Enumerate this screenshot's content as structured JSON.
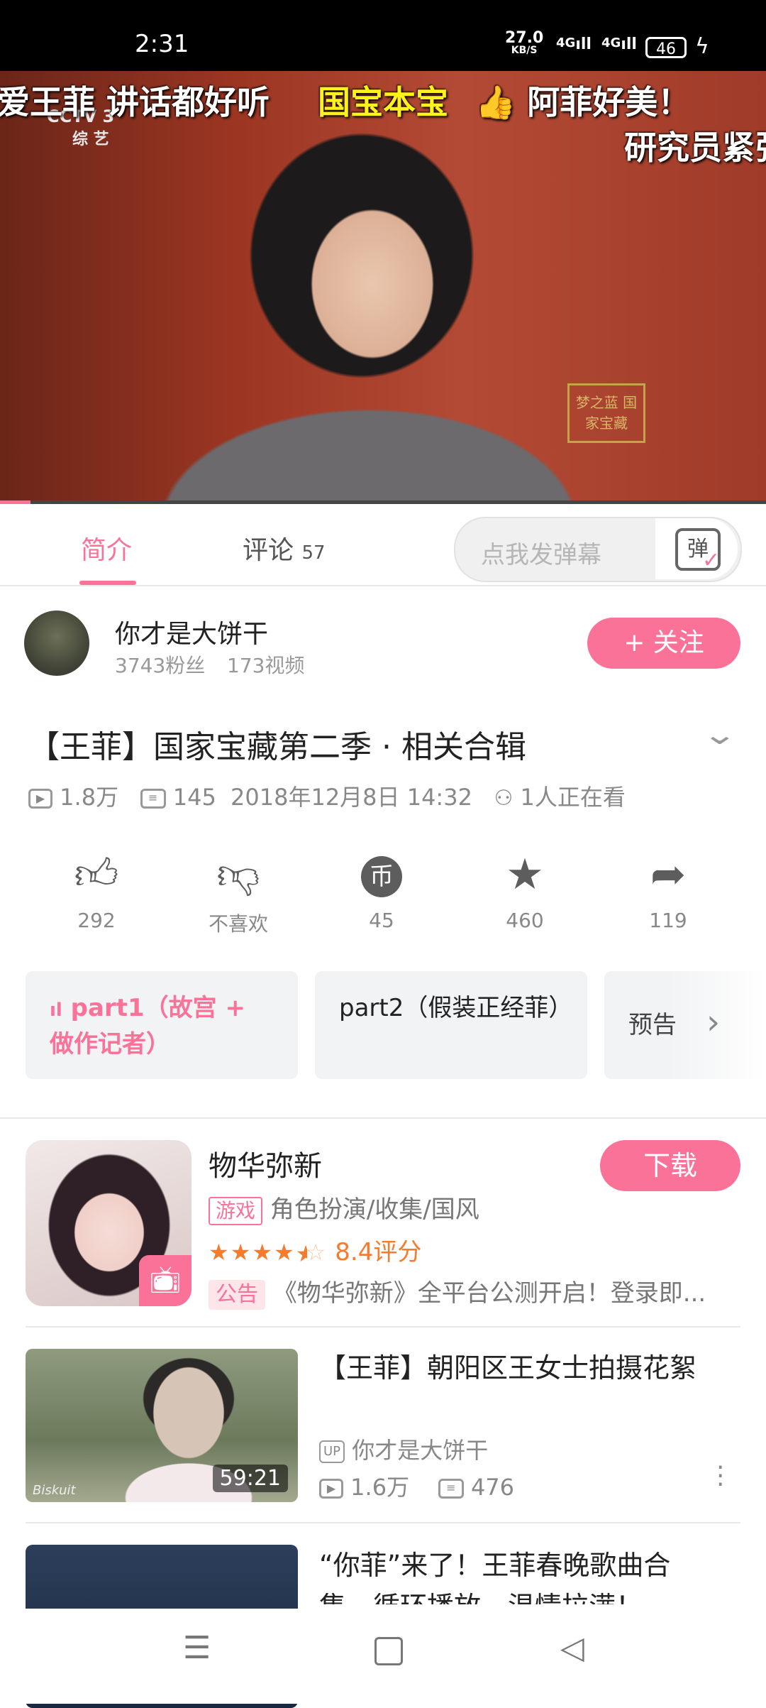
{
  "status_bar": {
    "time": "2:31",
    "speed": "27.0",
    "speed_unit": "KB/S",
    "signal1": "4G",
    "signal2": "4G",
    "battery": "46"
  },
  "video": {
    "channel_logo": "CCTV 3",
    "channel_sub": "综 艺",
    "watermark": "梦之蓝 国家宝藏",
    "danmaku": [
      {
        "text": "爱王菲 讲话都好听",
        "color": "#ffffff"
      },
      {
        "text": "国宝本宝",
        "color": "#fff21a"
      },
      {
        "text": "👍 阿菲好美！",
        "color": "#ffffff"
      },
      {
        "text": "研究员紧张",
        "color": "#ffffff"
      }
    ],
    "progress_fraction": 0.04
  },
  "tabs": {
    "intro": "简介",
    "comments": "评论",
    "comments_count": "57",
    "danmu_placeholder": "点我发弹幕",
    "danmu_button": "弹"
  },
  "uploader": {
    "name": "你才是大饼干",
    "fans": "3743粉丝",
    "videos": "173视频",
    "follow": "+ 关注"
  },
  "video_info": {
    "title": "【王菲】国家宝藏第二季 · 相关合辑",
    "views": "1.8万",
    "danmaku_count": "145",
    "date": "2018年12月8日 14:32",
    "watching": "1人正在看"
  },
  "actions": {
    "like": "292",
    "dislike": "不喜欢",
    "coin": "45",
    "favorite": "460",
    "share": "119"
  },
  "parts": [
    "part1（故宫 + 做作记者）",
    "part2（假装正经菲）",
    "预告"
  ],
  "ad": {
    "name": "物华弥新",
    "tag": "游戏",
    "genres": "角色扮演/收集/国风",
    "rating": "8.4评分",
    "rating_stars": 4.5,
    "notice_tag": "公告",
    "notice": "《物华弥新》全平台公测开启！登录即...",
    "download": "下载"
  },
  "related": [
    {
      "title": "【王菲】朝阳区王女士拍摄花絮",
      "duration": "59:21",
      "up": "你才是大饼干",
      "views": "1.6万",
      "danmaku": "476",
      "thumb_text": "Biskuit"
    },
    {
      "title": "“你菲”来了！王菲春晚歌曲合集，循环播放，温情拉满！"
    }
  ]
}
